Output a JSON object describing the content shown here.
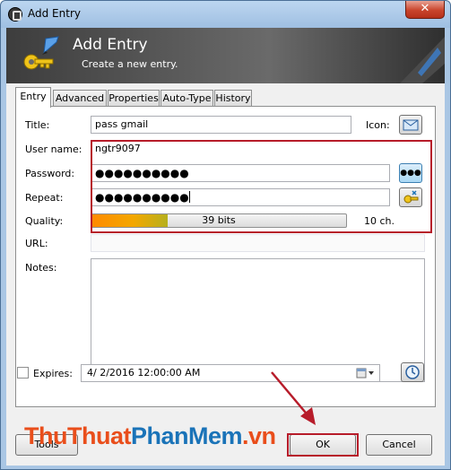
{
  "window": {
    "title": "Add Entry",
    "close_glyph": "✕"
  },
  "banner": {
    "title": "Add Entry",
    "subtitle": "Create a new entry."
  },
  "tabs": [
    {
      "label": "Entry",
      "active": true
    },
    {
      "label": "Advanced",
      "active": false
    },
    {
      "label": "Properties",
      "active": false
    },
    {
      "label": "Auto-Type",
      "active": false
    },
    {
      "label": "History",
      "active": false
    }
  ],
  "form": {
    "title_label": "Title:",
    "title_value": "pass gmail",
    "icon_label": "Icon:",
    "username_label": "User name:",
    "username_value": "ngtr9097",
    "password_label": "Password:",
    "password_value": "●●●●●●●●●●",
    "show_password_glyph": "●●●",
    "repeat_label": "Repeat:",
    "repeat_value": "●●●●●●●●●●",
    "quality_label": "Quality:",
    "quality_text": "39 bits",
    "quality_fraction": 0.3,
    "quality_chars": "10 ch.",
    "url_label": "URL:",
    "url_value": "",
    "notes_label": "Notes:",
    "expires_label": "Expires:",
    "expires_checked": false,
    "expires_value": "4/  2/2016 12:00:00 AM"
  },
  "buttons": {
    "tools": "Tools",
    "ok": "OK",
    "cancel": "Cancel"
  },
  "watermark": {
    "part1": "ThuThuat",
    "part2": "PhanMem",
    "part3": ".vn"
  },
  "colors": {
    "annotation_red": "#b71c2a",
    "quality_orange": "#ff8a00"
  },
  "icons": [
    "lock-icon",
    "keepass-key-icon",
    "envelope-icon",
    "show-password-icon",
    "generate-password-icon",
    "calendar-icon",
    "clock-icon"
  ]
}
